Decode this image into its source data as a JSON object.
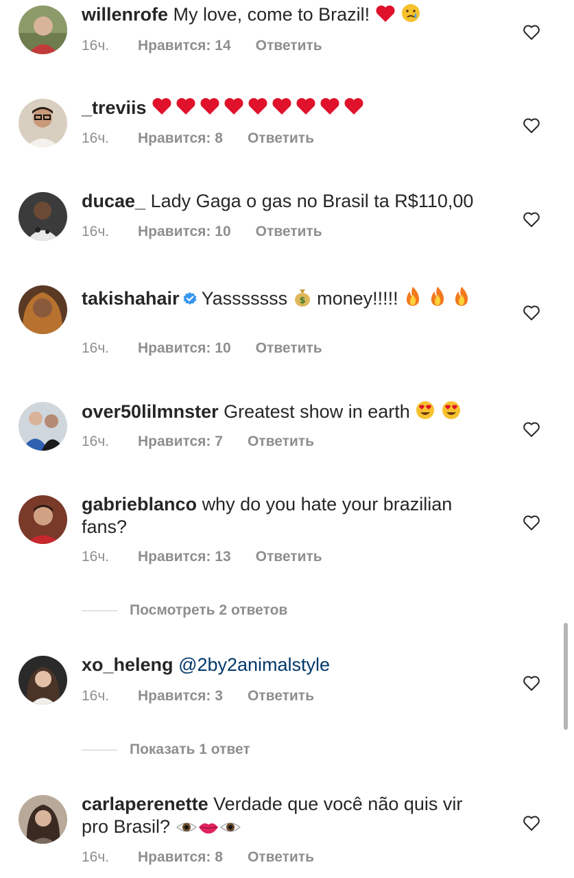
{
  "comments": [
    {
      "username": "willenrofe",
      "text": "My love, come to Brazil!",
      "time": "16ч.",
      "likes": "Нравится: 14",
      "reply": "Ответить"
    },
    {
      "username": "_treviis",
      "text": "",
      "time": "16ч.",
      "likes": "Нравится: 8",
      "reply": "Ответить"
    },
    {
      "username": "ducae_",
      "text": "Lady Gaga o gas no Brasil ta R$110,00",
      "time": "16ч.",
      "likes": "Нравится: 10",
      "reply": "Ответить"
    },
    {
      "username": "takishahair",
      "text_a": "Yasssssss",
      "text_b": "money!!!!!",
      "time": "16ч.",
      "likes": "Нравится: 10",
      "reply": "Ответить"
    },
    {
      "username": "over50lilmnster",
      "text": "Greatest show in earth",
      "time": "16ч.",
      "likes": "Нравится: 7",
      "reply": "Ответить"
    },
    {
      "username": "gabrieblanco",
      "text": "why do you hate your brazilian fans?",
      "time": "16ч.",
      "likes": "Нравится: 13",
      "reply": "Ответить",
      "view_replies": "Посмотреть 2 ответов"
    },
    {
      "username": "xo_heleng",
      "mention": "@2by2animalstyle",
      "time": "16ч.",
      "likes": "Нравится: 3",
      "reply": "Ответить",
      "view_replies": "Показать 1 ответ"
    },
    {
      "username": "carlaperenette",
      "text": "Verdade que você não quis vir pro Brasil?",
      "time": "16ч.",
      "likes": "Нравится: 8",
      "reply": "Ответить"
    }
  ],
  "colors": {
    "text": "#262626",
    "secondary": "#8e8e8e",
    "mention": "#00376b",
    "verified": "#3897f0",
    "heart_emoji": "#e0112b"
  },
  "icons": {
    "like": "heart-outline-icon",
    "verified": "verified-badge-icon"
  }
}
